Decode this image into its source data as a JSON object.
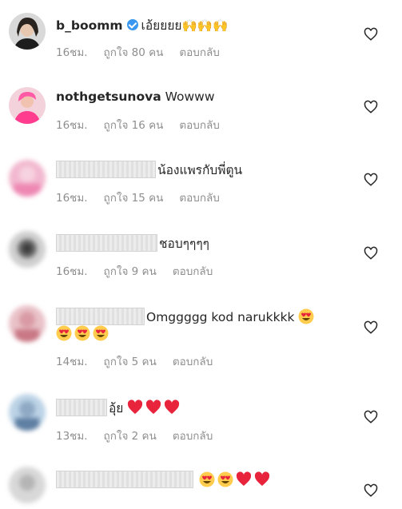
{
  "comments": [
    {
      "user": "b_boomm",
      "text": "เอ้ยยยย🙌🙌🙌",
      "time": "16ชม.",
      "likes": "ถูกใจ 80 คน",
      "reply": "ตอบกลับ",
      "verified": true
    },
    {
      "user": "nothgetsunova",
      "text": "Wowww",
      "time": "16ชม.",
      "likes": "ถูกใจ 16 คน",
      "reply": "ตอบกลับ"
    },
    {
      "user": "",
      "text": "น้องแพรกับพี่ตูน",
      "time": "16ชม.",
      "likes": "ถูกใจ 15 คน",
      "reply": "ตอบกลับ"
    },
    {
      "user": "",
      "text": "ชอบๆๆๆๆ",
      "time": "16ชม.",
      "likes": "ถูกใจ 9 คน",
      "reply": "ตอบกลับ"
    },
    {
      "user": "",
      "text": "Omggggg kod narukkkk",
      "text2": "😍😍😍",
      "time": "14ชม.",
      "likes": "ถูกใจ 5 คน",
      "reply": "ตอบกลับ"
    },
    {
      "user": "",
      "text": "อุ้ย",
      "time": "13ชม.",
      "likes": "ถูกใจ 2 คน",
      "reply": "ตอบกลับ"
    },
    {
      "user": "",
      "text": "",
      "time": "",
      "likes": "",
      "reply": ""
    }
  ],
  "icons": {
    "like": "heart-outline-icon",
    "verified": "verified-badge-icon"
  },
  "colors": {
    "text": "#262626",
    "meta": "#8e8e8e",
    "verified": "#3897f0",
    "heart_red": "#e8243c"
  }
}
